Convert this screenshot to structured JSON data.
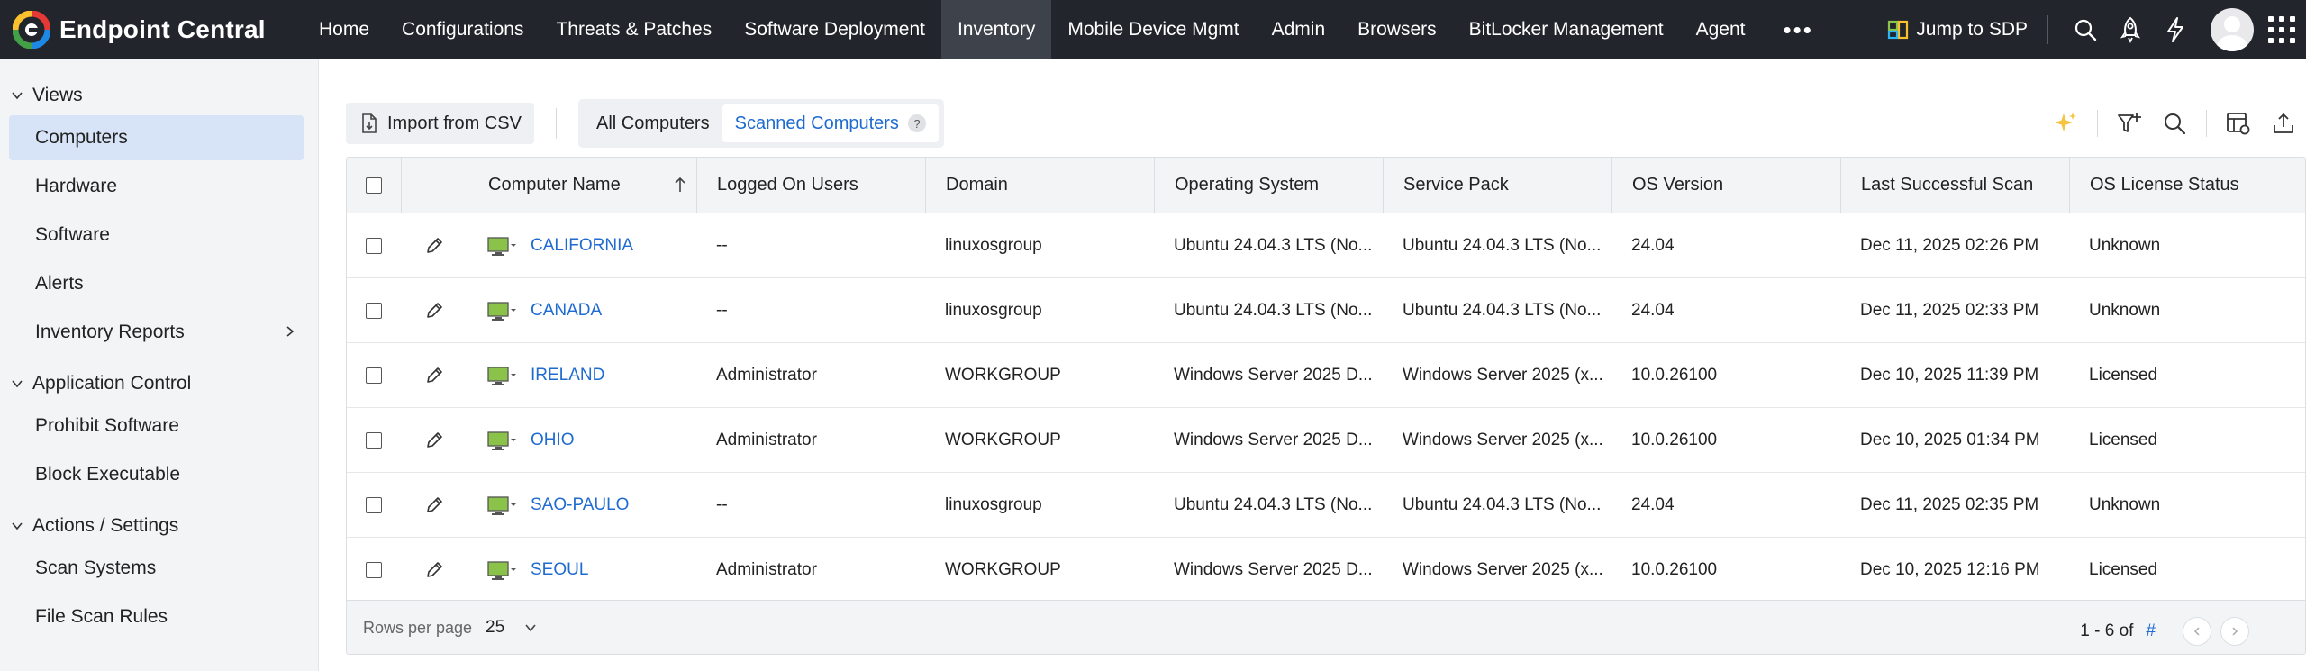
{
  "app": {
    "name": "Endpoint Central",
    "logo_colors": [
      "#e53935",
      "#fbc02d",
      "#43a047",
      "#1e88e5"
    ]
  },
  "nav": {
    "items": [
      {
        "label": "Home"
      },
      {
        "label": "Configurations"
      },
      {
        "label": "Threats & Patches"
      },
      {
        "label": "Software Deployment"
      },
      {
        "label": "Inventory",
        "active": true
      },
      {
        "label": "Mobile Device Mgmt"
      },
      {
        "label": "Admin"
      },
      {
        "label": "Browsers"
      },
      {
        "label": "BitLocker Management"
      },
      {
        "label": "Agent"
      }
    ],
    "more_label": "•••",
    "jump_label": "Jump to SDP"
  },
  "sidebar": {
    "groups": [
      {
        "label": "Views",
        "items": [
          {
            "label": "Computers",
            "active": true
          },
          {
            "label": "Hardware"
          },
          {
            "label": "Software"
          },
          {
            "label": "Alerts"
          },
          {
            "label": "Inventory Reports",
            "has_submenu": true
          }
        ]
      },
      {
        "label": "Application Control",
        "items": [
          {
            "label": "Prohibit Software"
          },
          {
            "label": "Block Executable"
          }
        ]
      },
      {
        "label": "Actions / Settings",
        "items": [
          {
            "label": "Scan Systems"
          },
          {
            "label": "File Scan Rules"
          }
        ]
      }
    ]
  },
  "toolbar": {
    "import_label": "Import from CSV",
    "tabs": [
      {
        "label": "All Computers"
      },
      {
        "label": "Scanned Computers",
        "active": true
      }
    ],
    "help_label": "?"
  },
  "table": {
    "columns": [
      "Computer Name",
      "Logged On Users",
      "Domain",
      "Operating System",
      "Service Pack",
      "OS Version",
      "Last Successful Scan",
      "OS License Status"
    ],
    "rows": [
      {
        "name": "CALIFORNIA",
        "users": "--",
        "domain": "linuxosgroup",
        "os": "Ubuntu 24.04.3 LTS (No...",
        "sp": "Ubuntu 24.04.3 LTS (No...",
        "version": "24.04",
        "scan": "Dec 11, 2025 02:26 PM",
        "license": "Unknown"
      },
      {
        "name": "CANADA",
        "users": "--",
        "domain": "linuxosgroup",
        "os": "Ubuntu 24.04.3 LTS (No...",
        "sp": "Ubuntu 24.04.3 LTS (No...",
        "version": "24.04",
        "scan": "Dec 11, 2025 02:33 PM",
        "license": "Unknown"
      },
      {
        "name": "IRELAND",
        "users": "Administrator",
        "domain": "WORKGROUP",
        "os": "Windows Server 2025 D...",
        "sp": "Windows Server 2025 (x...",
        "version": "10.0.26100",
        "scan": "Dec 10, 2025 11:39 PM",
        "license": "Licensed"
      },
      {
        "name": "OHIO",
        "users": "Administrator",
        "domain": "WORKGROUP",
        "os": "Windows Server 2025 D...",
        "sp": "Windows Server 2025 (x...",
        "version": "10.0.26100",
        "scan": "Dec 10, 2025 01:34 PM",
        "license": "Licensed"
      },
      {
        "name": "SAO-PAULO",
        "users": "--",
        "domain": "linuxosgroup",
        "os": "Ubuntu 24.04.3 LTS (No...",
        "sp": "Ubuntu 24.04.3 LTS (No...",
        "version": "24.04",
        "scan": "Dec 11, 2025 02:35 PM",
        "license": "Unknown"
      },
      {
        "name": "SEOUL",
        "users": "Administrator",
        "domain": "WORKGROUP",
        "os": "Windows Server 2025 D...",
        "sp": "Windows Server 2025 (x...",
        "version": "10.0.26100",
        "scan": "Dec 10, 2025 12:16 PM",
        "license": "Licensed"
      }
    ],
    "footer": {
      "rows_per_page_label": "Rows per page",
      "rows_per_page": "25",
      "range": "1 - 6 of",
      "total_link": "#"
    }
  },
  "colors": {
    "topbar": "#22252b",
    "accent": "#1f6bd1",
    "sidebar_active": "#d7e3f6",
    "monitor_screen": "#8bc34a"
  }
}
